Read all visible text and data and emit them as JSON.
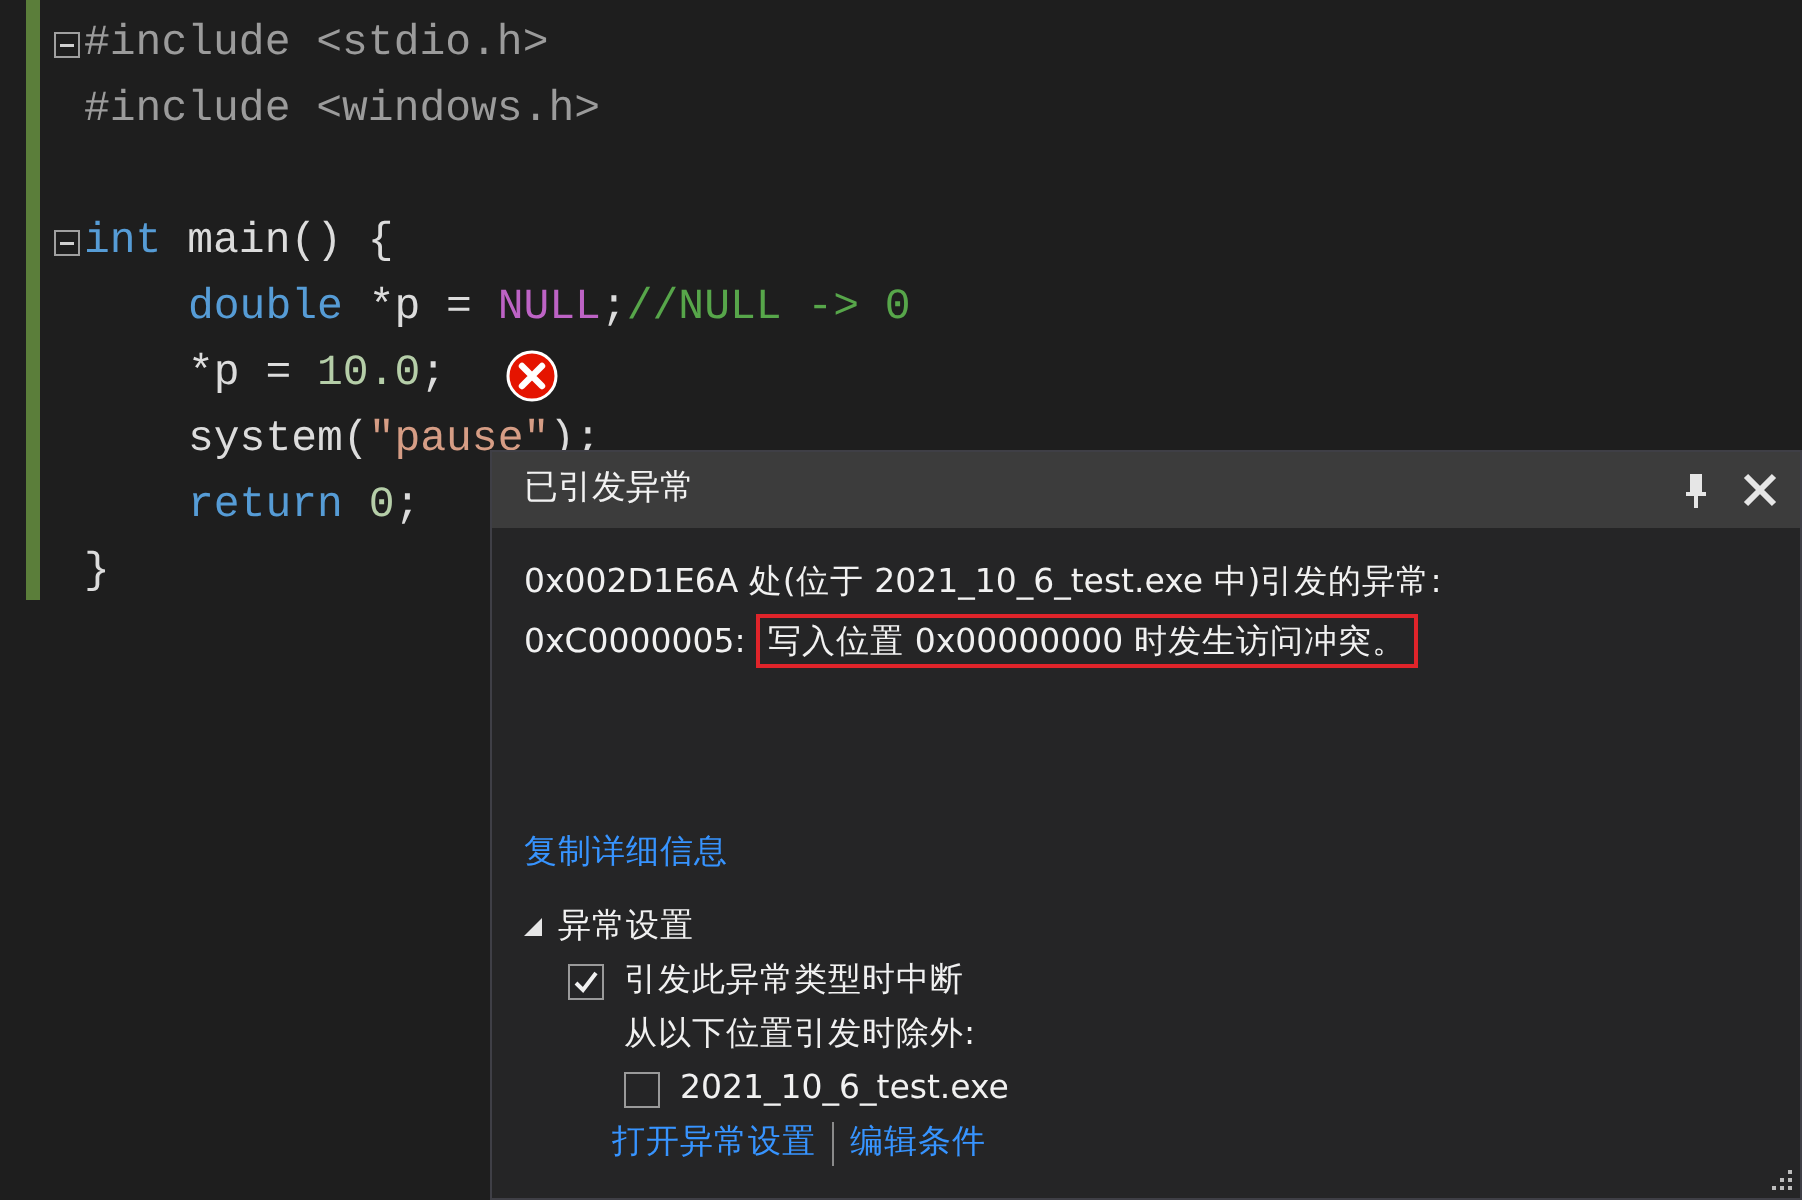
{
  "editor": {
    "lines": [
      {
        "fold": true,
        "tokens": [
          {
            "kind": "preproc",
            "text": "#include <stdio.h>"
          }
        ]
      },
      {
        "fold": false,
        "tokens": [
          {
            "kind": "preproc",
            "text": "#include <windows.h>"
          }
        ]
      },
      {
        "fold": false
      },
      {
        "fold": true,
        "tokens": [
          {
            "kind": "keyword",
            "text": "int"
          },
          {
            "kind": "plain",
            "text": " main() {"
          }
        ],
        "children": [
          {
            "fold": false,
            "tokens": [
              {
                "kind": "keyword",
                "text": "double"
              },
              {
                "kind": "plain",
                "text": " *p = "
              },
              {
                "kind": "macro",
                "text": "NULL"
              },
              {
                "kind": "plain",
                "text": ";"
              },
              {
                "kind": "comment",
                "text": "//NULL -> 0"
              }
            ]
          },
          {
            "fold": false,
            "error": true,
            "tokens": [
              {
                "kind": "plain",
                "text": "*p = "
              },
              {
                "kind": "number",
                "text": "10.0"
              },
              {
                "kind": "plain",
                "text": ";"
              }
            ]
          },
          {
            "fold": false,
            "tokens": [
              {
                "kind": "plain",
                "text": "system("
              },
              {
                "kind": "string",
                "text": "\"pause\""
              },
              {
                "kind": "plain",
                "text": ");"
              }
            ]
          },
          {
            "fold": false,
            "tokens": [
              {
                "kind": "keyword",
                "text": "return"
              },
              {
                "kind": "number",
                "text": " 0"
              },
              {
                "kind": "plain",
                "text": ";"
              }
            ]
          }
        ]
      },
      {
        "fold": false,
        "tokens": [
          {
            "kind": "plain",
            "text": "}"
          }
        ]
      }
    ]
  },
  "exception": {
    "title": "已引发异常",
    "message": [
      [
        {
          "text": "0x002D1E6A 处(位于 2021_10_6_test.exe 中)引发的异常:",
          "highlighted": false
        }
      ],
      [
        {
          "text": "0xC0000005: ",
          "highlighted": false
        },
        {
          "text": "写入位置 0x00000000 时发生访问冲突。",
          "highlighted": true
        }
      ]
    ],
    "copy_link": "复制详细信息",
    "settings": {
      "title": "异常设置",
      "expanded": true,
      "items": [
        {
          "kind": "checkbox",
          "label": "引发此异常类型时中断",
          "checked": true
        },
        {
          "kind": "label",
          "label": "从以下位置引发时除外:",
          "children": [
            {
              "kind": "checkbox",
              "label": "2021_10_6_test.exe",
              "checked": false
            }
          ]
        }
      ]
    },
    "links": [
      "打开异常设置",
      "编辑条件"
    ]
  }
}
